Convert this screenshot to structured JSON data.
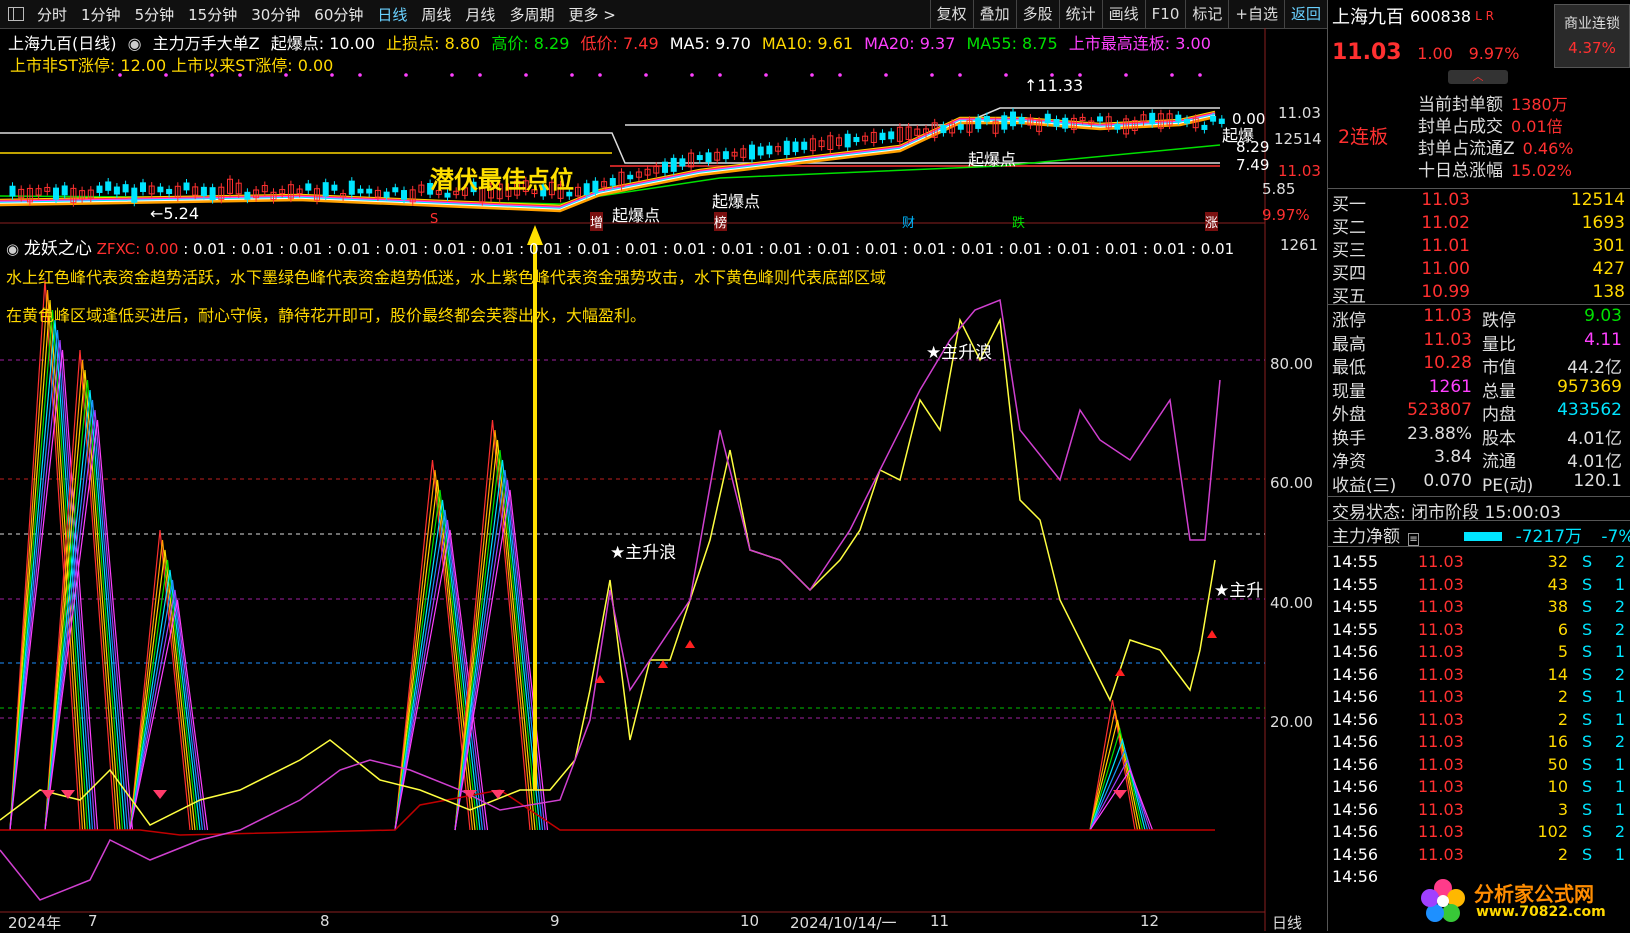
{
  "toolbar": {
    "periods": [
      "分时",
      "1分钟",
      "5分钟",
      "15分钟",
      "30分钟",
      "60分钟",
      "日线",
      "周线",
      "月线",
      "多周期",
      "更多 >"
    ],
    "active_period": "日线",
    "tools": [
      "复权",
      "叠加",
      "多股",
      "统计",
      "画线",
      "F10",
      "标记",
      "+自选",
      "返回"
    ]
  },
  "info_line": {
    "title": "上海九百(日线)",
    "indicator": "主力万手大单Z",
    "qibao": "起爆点: 10.00",
    "stop": "止损点: 8.80",
    "high": "高价: 8.29",
    "low": "低价: 7.49",
    "ma5": "MA5: 9.70",
    "ma10": "MA10: 9.61",
    "ma20": "MA20: 9.37",
    "ma55": "MA55: 8.75",
    "max_lianban": "上市最高连板: 3.00"
  },
  "info_line2": "上市非ST涨停: 12.00  上市以来ST涨停: 0.00",
  "main_chart": {
    "axis": [
      "11.03",
      "12514",
      "11.03",
      "5.85",
      "9.97%"
    ],
    "right_values": [
      "0.00",
      "8.29",
      "7.49"
    ],
    "high_label": "11.33",
    "low_label": "5.24",
    "callout": "潜伏最佳点位",
    "tags": [
      "起爆点",
      "起爆点",
      "起爆点",
      "起爆"
    ],
    "events": [
      "S",
      "增",
      "榜",
      "财",
      "跌",
      "涨"
    ]
  },
  "indicator_panel": {
    "name": "龙妖之心",
    "key": "ZFXC: 0.00",
    "values": ": 0.01 : 0.01 : 0.01 : 0.01 : 0.01 : 0.01 : 0.01 : 0.01 : 0.01 : 0.01 : 0.01 : 0.01 : 0.01 : 0.01 : 0.01 : 0.01 : 0.01 : 0.01 : 0.01 : 0.01 : 0.01 : 0.01",
    "value_right": "1261",
    "desc1": "水上红色峰代表资金趋势活跃，水下墨绿色峰代表资金趋势低迷，水上紫色峰代表资金强势攻击，水下黄色峰则代表底部区域",
    "desc2": "在黄色峰区域逢低买进后，耐心守候，静待花开即可，股价最终都会芙蓉出水，大幅盈利。",
    "axis": [
      "80.00",
      "60.00",
      "40.00",
      "20.00"
    ],
    "wave_label": "主升浪",
    "wave_label_short": "主升",
    "x_labels": [
      "2024年",
      "7",
      "8",
      "9",
      "10",
      "2024/10/14/一",
      "11",
      "12"
    ],
    "period_label": "日线"
  },
  "quote": {
    "name": "上海九百",
    "code": "600838",
    "lr": "L R",
    "badge_title": "商业连锁",
    "badge_value": "4.37%",
    "price": "11.03",
    "change": "1.00",
    "pct": "9.97%",
    "tag": "2连板",
    "seal": [
      {
        "label": "当前封单额",
        "value": "1380万"
      },
      {
        "label": "封单占成交",
        "value": "0.01倍"
      },
      {
        "label": "封单占流通Z",
        "value": "0.46%"
      },
      {
        "label": "十日总涨幅",
        "value": "15.02%"
      }
    ],
    "bids": [
      {
        "label": "买一",
        "price": "11.03",
        "vol": "12514"
      },
      {
        "label": "买二",
        "price": "11.02",
        "vol": "1693"
      },
      {
        "label": "买三",
        "price": "11.01",
        "vol": "301"
      },
      {
        "label": "买四",
        "price": "11.00",
        "vol": "427"
      },
      {
        "label": "买五",
        "price": "10.99",
        "vol": "138"
      }
    ],
    "stats": [
      {
        "label": "涨停",
        "value": "11.03",
        "color": "#ff3030"
      },
      {
        "label": "跌停",
        "value": "9.03",
        "color": "#00e000"
      },
      {
        "label": "最高",
        "value": "11.03",
        "color": "#ff3030"
      },
      {
        "label": "量比",
        "value": "4.11",
        "color": "#ff40ff"
      },
      {
        "label": "最低",
        "value": "10.28",
        "color": "#ff3030"
      },
      {
        "label": "市值",
        "value": "44.2亿",
        "color": "#ddd"
      },
      {
        "label": "现量",
        "value": "1261",
        "color": "#ff40ff"
      },
      {
        "label": "总量",
        "value": "957369",
        "color": "#ffd800"
      },
      {
        "label": "外盘",
        "value": "523807",
        "color": "#ff3030"
      },
      {
        "label": "内盘",
        "value": "433562",
        "color": "#00e5ff"
      },
      {
        "label": "换手",
        "value": "23.88%",
        "color": "#ddd"
      },
      {
        "label": "股本",
        "value": "4.01亿",
        "color": "#ddd"
      },
      {
        "label": "净资",
        "value": "3.84",
        "color": "#ddd"
      },
      {
        "label": "流通",
        "value": "4.01亿",
        "color": "#ddd"
      },
      {
        "label": "收益(三)",
        "value": "0.070",
        "color": "#ddd"
      },
      {
        "label": "PE(动)",
        "value": "120.1",
        "color": "#ddd"
      }
    ],
    "trade_state": "交易状态: 闭市阶段 15:00:03",
    "zljlr_label": "主力净额",
    "zljlr_value": "-7217万",
    "zljlr_pct": "-7%",
    "ticks": [
      {
        "t": "14:55",
        "p": "11.03",
        "v": "32",
        "s": "S",
        "n": "2"
      },
      {
        "t": "14:55",
        "p": "11.03",
        "v": "43",
        "s": "S",
        "n": "1"
      },
      {
        "t": "14:55",
        "p": "11.03",
        "v": "38",
        "s": "S",
        "n": "2"
      },
      {
        "t": "14:55",
        "p": "11.03",
        "v": "6",
        "s": "S",
        "n": "2"
      },
      {
        "t": "14:56",
        "p": "11.03",
        "v": "5",
        "s": "S",
        "n": "1"
      },
      {
        "t": "14:56",
        "p": "11.03",
        "v": "14",
        "s": "S",
        "n": "2"
      },
      {
        "t": "14:56",
        "p": "11.03",
        "v": "2",
        "s": "S",
        "n": "1"
      },
      {
        "t": "14:56",
        "p": "11.03",
        "v": "2",
        "s": "S",
        "n": "1"
      },
      {
        "t": "14:56",
        "p": "11.03",
        "v": "16",
        "s": "S",
        "n": "2"
      },
      {
        "t": "14:56",
        "p": "11.03",
        "v": "50",
        "s": "S",
        "n": "1"
      },
      {
        "t": "14:56",
        "p": "11.03",
        "v": "10",
        "s": "S",
        "n": "1"
      },
      {
        "t": "14:56",
        "p": "11.03",
        "v": "3",
        "s": "S",
        "n": "1"
      },
      {
        "t": "14:56",
        "p": "11.03",
        "v": "102",
        "s": "S",
        "n": "2"
      },
      {
        "t": "14:56",
        "p": "11.03",
        "v": "2",
        "s": "S",
        "n": "1"
      },
      {
        "t": "14:56",
        "p": "",
        "v": "",
        "s": "",
        "n": ""
      }
    ],
    "logo_text": "分析家公式网",
    "logo_url": "www.70822.com"
  }
}
